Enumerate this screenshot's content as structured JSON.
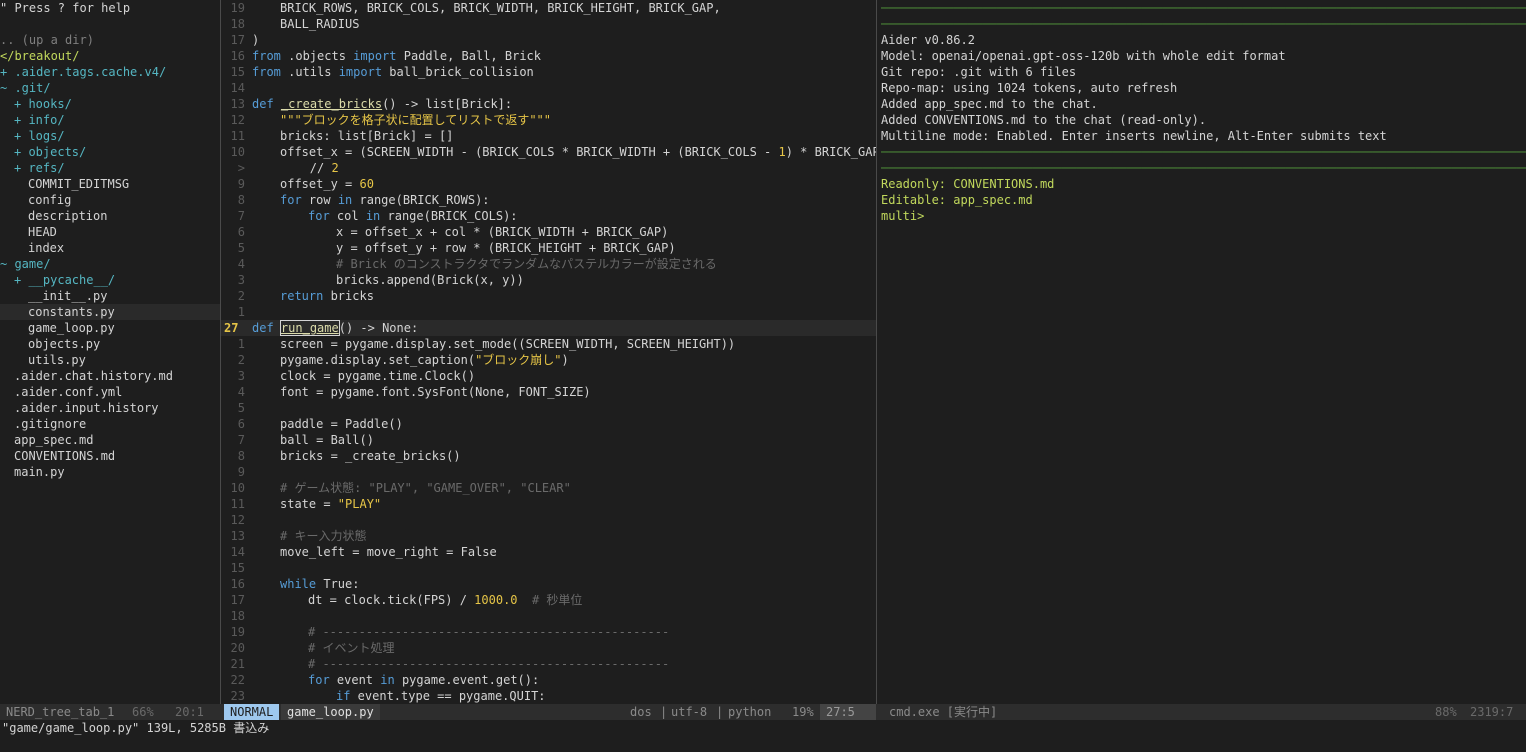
{
  "nerdtree": {
    "help": "\" Press ? for help",
    "updir": ".. (up a dir)",
    "cwd": "</breakout/",
    "entries": [
      {
        "indent": 0,
        "mark": "+ ",
        "name": ".aider.tags.cache.v4/",
        "type": "dir"
      },
      {
        "indent": 0,
        "mark": "~ ",
        "name": ".git/",
        "type": "dir"
      },
      {
        "indent": 1,
        "mark": "+ ",
        "name": "hooks/",
        "type": "dir"
      },
      {
        "indent": 1,
        "mark": "+ ",
        "name": "info/",
        "type": "dir"
      },
      {
        "indent": 1,
        "mark": "+ ",
        "name": "logs/",
        "type": "dir"
      },
      {
        "indent": 1,
        "mark": "+ ",
        "name": "objects/",
        "type": "dir"
      },
      {
        "indent": 1,
        "mark": "+ ",
        "name": "refs/",
        "type": "dir"
      },
      {
        "indent": 2,
        "mark": "",
        "name": "COMMIT_EDITMSG",
        "type": "file"
      },
      {
        "indent": 2,
        "mark": "",
        "name": "config",
        "type": "file"
      },
      {
        "indent": 2,
        "mark": "",
        "name": "description",
        "type": "file"
      },
      {
        "indent": 2,
        "mark": "",
        "name": "HEAD",
        "type": "file"
      },
      {
        "indent": 2,
        "mark": "",
        "name": "index",
        "type": "file"
      },
      {
        "indent": 0,
        "mark": "~ ",
        "name": "game/",
        "type": "dir"
      },
      {
        "indent": 1,
        "mark": "+ ",
        "name": "__pycache__/",
        "type": "dir"
      },
      {
        "indent": 2,
        "mark": "",
        "name": "__init__.py",
        "type": "file"
      },
      {
        "indent": 2,
        "mark": "",
        "name": "constants.py",
        "type": "file",
        "selected": true
      },
      {
        "indent": 2,
        "mark": "",
        "name": "game_loop.py",
        "type": "file"
      },
      {
        "indent": 2,
        "mark": "",
        "name": "objects.py",
        "type": "file"
      },
      {
        "indent": 2,
        "mark": "",
        "name": "utils.py",
        "type": "file"
      },
      {
        "indent": 1,
        "mark": "",
        "name": ".aider.chat.history.md",
        "type": "file"
      },
      {
        "indent": 1,
        "mark": "",
        "name": ".aider.conf.yml",
        "type": "file"
      },
      {
        "indent": 1,
        "mark": "",
        "name": ".aider.input.history",
        "type": "file"
      },
      {
        "indent": 1,
        "mark": "",
        "name": ".gitignore",
        "type": "file"
      },
      {
        "indent": 1,
        "mark": "",
        "name": "app_spec.md",
        "type": "file"
      },
      {
        "indent": 1,
        "mark": "",
        "name": "CONVENTIONS.md",
        "type": "file"
      },
      {
        "indent": 1,
        "mark": "",
        "name": "main.py",
        "type": "file"
      }
    ]
  },
  "editor": {
    "lines": [
      {
        "n": "19",
        "ind": 1,
        "segs": [
          [
            "",
            "BRICK_ROWS, BRICK_COLS, BRICK_WIDTH, BRICK_HEIGHT, BRICK_GAP,"
          ]
        ]
      },
      {
        "n": "18",
        "ind": 1,
        "segs": [
          [
            "",
            "BALL_RADIUS"
          ]
        ]
      },
      {
        "n": "17",
        "ind": 0,
        "segs": [
          [
            "",
            ")"
          ]
        ]
      },
      {
        "n": "16",
        "ind": 0,
        "segs": [
          [
            "kw",
            "from"
          ],
          [
            "",
            " .objects "
          ],
          [
            "kw",
            "import"
          ],
          [
            "",
            " Paddle, Ball, Brick"
          ]
        ]
      },
      {
        "n": "15",
        "ind": 0,
        "segs": [
          [
            "kw",
            "from"
          ],
          [
            "",
            " .utils "
          ],
          [
            "kw",
            "import"
          ],
          [
            "",
            " ball_brick_collision"
          ]
        ]
      },
      {
        "n": "14",
        "ind": 0,
        "segs": []
      },
      {
        "n": "13",
        "ind": 0,
        "segs": [
          [
            "kw",
            "def"
          ],
          [
            "",
            " "
          ],
          [
            "fn",
            "_create_bricks"
          ],
          [
            "",
            "() -> list[Brick]:"
          ]
        ]
      },
      {
        "n": "12",
        "ind": 1,
        "segs": [
          [
            "str",
            "\"\"\"ブロックを格子状に配置してリストで返す\"\"\""
          ]
        ]
      },
      {
        "n": "11",
        "ind": 1,
        "segs": [
          [
            "",
            "bricks: list[Brick] = []"
          ]
        ]
      },
      {
        "n": "10",
        "ind": 1,
        "segs": [
          [
            "",
            "offset_x = (SCREEN_WIDTH - (BRICK_COLS * BRICK_WIDTH + (BRICK_COLS - "
          ],
          [
            "num",
            "1"
          ],
          [
            "",
            ") * BRICK_GAP))"
          ]
        ]
      },
      {
        "n": ">",
        "ind": 0,
        "wrap": true,
        "segs": [
          [
            "",
            "        // "
          ],
          [
            "num",
            "2"
          ]
        ]
      },
      {
        "n": "9",
        "ind": 1,
        "segs": [
          [
            "",
            "offset_y = "
          ],
          [
            "num",
            "60"
          ]
        ]
      },
      {
        "n": "8",
        "ind": 1,
        "segs": [
          [
            "kw",
            "for"
          ],
          [
            "",
            " row "
          ],
          [
            "kw",
            "in"
          ],
          [
            "",
            " range(BRICK_ROWS):"
          ]
        ]
      },
      {
        "n": "7",
        "ind": 2,
        "segs": [
          [
            "kw",
            "for"
          ],
          [
            "",
            " col "
          ],
          [
            "kw",
            "in"
          ],
          [
            "",
            " range(BRICK_COLS):"
          ]
        ]
      },
      {
        "n": "6",
        "ind": 3,
        "segs": [
          [
            "",
            "x = offset_x + col * (BRICK_WIDTH + BRICK_GAP)"
          ]
        ]
      },
      {
        "n": "5",
        "ind": 3,
        "segs": [
          [
            "",
            "y = offset_y + row * (BRICK_HEIGHT + BRICK_GAP)"
          ]
        ]
      },
      {
        "n": "4",
        "ind": 3,
        "segs": [
          [
            "cmt",
            "# Brick のコンストラクタでランダムなパステルカラーが設定される"
          ]
        ]
      },
      {
        "n": "3",
        "ind": 3,
        "segs": [
          [
            "",
            "bricks.append(Brick(x, y))"
          ]
        ]
      },
      {
        "n": "2",
        "ind": 1,
        "segs": [
          [
            "kw",
            "return"
          ],
          [
            "",
            " bricks"
          ]
        ]
      },
      {
        "n": "1",
        "ind": 0,
        "segs": []
      },
      {
        "n": "27",
        "ind": 0,
        "cur": true,
        "segs": [
          [
            "kw",
            "def"
          ],
          [
            "",
            " "
          ],
          [
            "fn",
            "run_game"
          ],
          [
            "",
            "() -> None:"
          ]
        ]
      },
      {
        "n": "1",
        "ind": 1,
        "segs": [
          [
            "",
            "screen = pygame.display.set_mode((SCREEN_WIDTH, SCREEN_HEIGHT))"
          ]
        ]
      },
      {
        "n": "2",
        "ind": 1,
        "segs": [
          [
            "",
            "pygame.display.set_caption("
          ],
          [
            "str",
            "\"ブロック崩し\""
          ],
          [
            "",
            ")"
          ]
        ]
      },
      {
        "n": "3",
        "ind": 1,
        "segs": [
          [
            "",
            "clock = pygame.time.Clock()"
          ]
        ]
      },
      {
        "n": "4",
        "ind": 1,
        "segs": [
          [
            "",
            "font = pygame.font.SysFont(None, FONT_SIZE)"
          ]
        ]
      },
      {
        "n": "5",
        "ind": 0,
        "segs": []
      },
      {
        "n": "6",
        "ind": 1,
        "segs": [
          [
            "",
            "paddle = Paddle()"
          ]
        ]
      },
      {
        "n": "7",
        "ind": 1,
        "segs": [
          [
            "",
            "ball = Ball()"
          ]
        ]
      },
      {
        "n": "8",
        "ind": 1,
        "segs": [
          [
            "",
            "bricks = _create_bricks()"
          ]
        ]
      },
      {
        "n": "9",
        "ind": 0,
        "segs": []
      },
      {
        "n": "10",
        "ind": 1,
        "segs": [
          [
            "cmt",
            "# ゲーム状態: \"PLAY\", \"GAME_OVER\", \"CLEAR\""
          ]
        ]
      },
      {
        "n": "11",
        "ind": 1,
        "segs": [
          [
            "",
            "state = "
          ],
          [
            "str",
            "\"PLAY\""
          ]
        ]
      },
      {
        "n": "12",
        "ind": 0,
        "segs": []
      },
      {
        "n": "13",
        "ind": 1,
        "segs": [
          [
            "cmt",
            "# キー入力状態"
          ]
        ]
      },
      {
        "n": "14",
        "ind": 1,
        "segs": [
          [
            "",
            "move_left = move_right = False"
          ]
        ]
      },
      {
        "n": "15",
        "ind": 0,
        "segs": []
      },
      {
        "n": "16",
        "ind": 1,
        "segs": [
          [
            "kw",
            "while"
          ],
          [
            "",
            " True:"
          ]
        ]
      },
      {
        "n": "17",
        "ind": 2,
        "segs": [
          [
            "",
            "dt = clock.tick(FPS) / "
          ],
          [
            "num",
            "1000.0"
          ],
          [
            "",
            "  "
          ],
          [
            "cmt",
            "# 秒単位"
          ]
        ]
      },
      {
        "n": "18",
        "ind": 0,
        "segs": []
      },
      {
        "n": "19",
        "ind": 2,
        "segs": [
          [
            "cmt",
            "# ------------------------------------------------"
          ]
        ]
      },
      {
        "n": "20",
        "ind": 2,
        "segs": [
          [
            "cmt",
            "# イベント処理"
          ]
        ]
      },
      {
        "n": "21",
        "ind": 2,
        "segs": [
          [
            "cmt",
            "# ------------------------------------------------"
          ]
        ]
      },
      {
        "n": "22",
        "ind": 2,
        "segs": [
          [
            "kw",
            "for"
          ],
          [
            "",
            " event "
          ],
          [
            "kw",
            "in"
          ],
          [
            "",
            " pygame.event.get():"
          ]
        ]
      },
      {
        "n": "23",
        "ind": 3,
        "segs": [
          [
            "kw",
            "if"
          ],
          [
            "",
            " event.type == pygame.QUIT:"
          ]
        ]
      }
    ]
  },
  "terminal": {
    "lines": [
      {
        "c": "sep",
        "t": "──────────────────────────────────────────────────────────────────────────────────────────"
      },
      {
        "c": "sep",
        "t": "──────────────────────────────────────────────────────────────────────────────────────────"
      },
      {
        "c": "white",
        "t": "Aider v0.86.2"
      },
      {
        "c": "white",
        "t": "Model: openai/openai.gpt-oss-120b with whole edit format"
      },
      {
        "c": "white",
        "t": "Git repo: .git with 6 files"
      },
      {
        "c": "white",
        "t": "Repo-map: using 1024 tokens, auto refresh"
      },
      {
        "c": "white",
        "t": "Added app_spec.md to the chat."
      },
      {
        "c": "white",
        "t": "Added CONVENTIONS.md to the chat (read-only)."
      },
      {
        "c": "white",
        "t": "Multiline mode: Enabled. Enter inserts newline, Alt-Enter submits text"
      },
      {
        "c": "sep",
        "t": "──────────────────────────────────────────────────────────────────────────────────────────"
      },
      {
        "c": "sep",
        "t": "──────────────────────────────────────────────────────────────────────────────────────────"
      },
      {
        "c": "green",
        "t": "Readonly: CONVENTIONS.md"
      },
      {
        "c": "green",
        "t": "Editable: app_spec.md"
      },
      {
        "c": "green",
        "t": "multi> "
      }
    ]
  },
  "statusbar": {
    "nerd_name": "NERD_tree_tab_1",
    "nerd_pct": "66%",
    "nerd_pos": "20:1",
    "mode": "NORMAL",
    "file": "game_loop.py",
    "fileformat": "dos",
    "sep1": "|",
    "encoding": "utf-8",
    "sep2": "|",
    "filetype": "python",
    "pct": "19%",
    "pos": "27:5",
    "term_title": "cmd.exe [実行中]",
    "term_pct": "88%",
    "term_pos": "2319:7"
  },
  "cmdline": "\"game/game_loop.py\" 139L, 5285B 書込み",
  "colors": {
    "background": "#1e1e1e",
    "keyword": "#569cd6",
    "string": "#e6c547",
    "comment": "#6a6a6a",
    "nerd_dir": "#55b6c2",
    "terminal_green": "#c1d85c",
    "mode_badge": "#9ec8ee"
  }
}
